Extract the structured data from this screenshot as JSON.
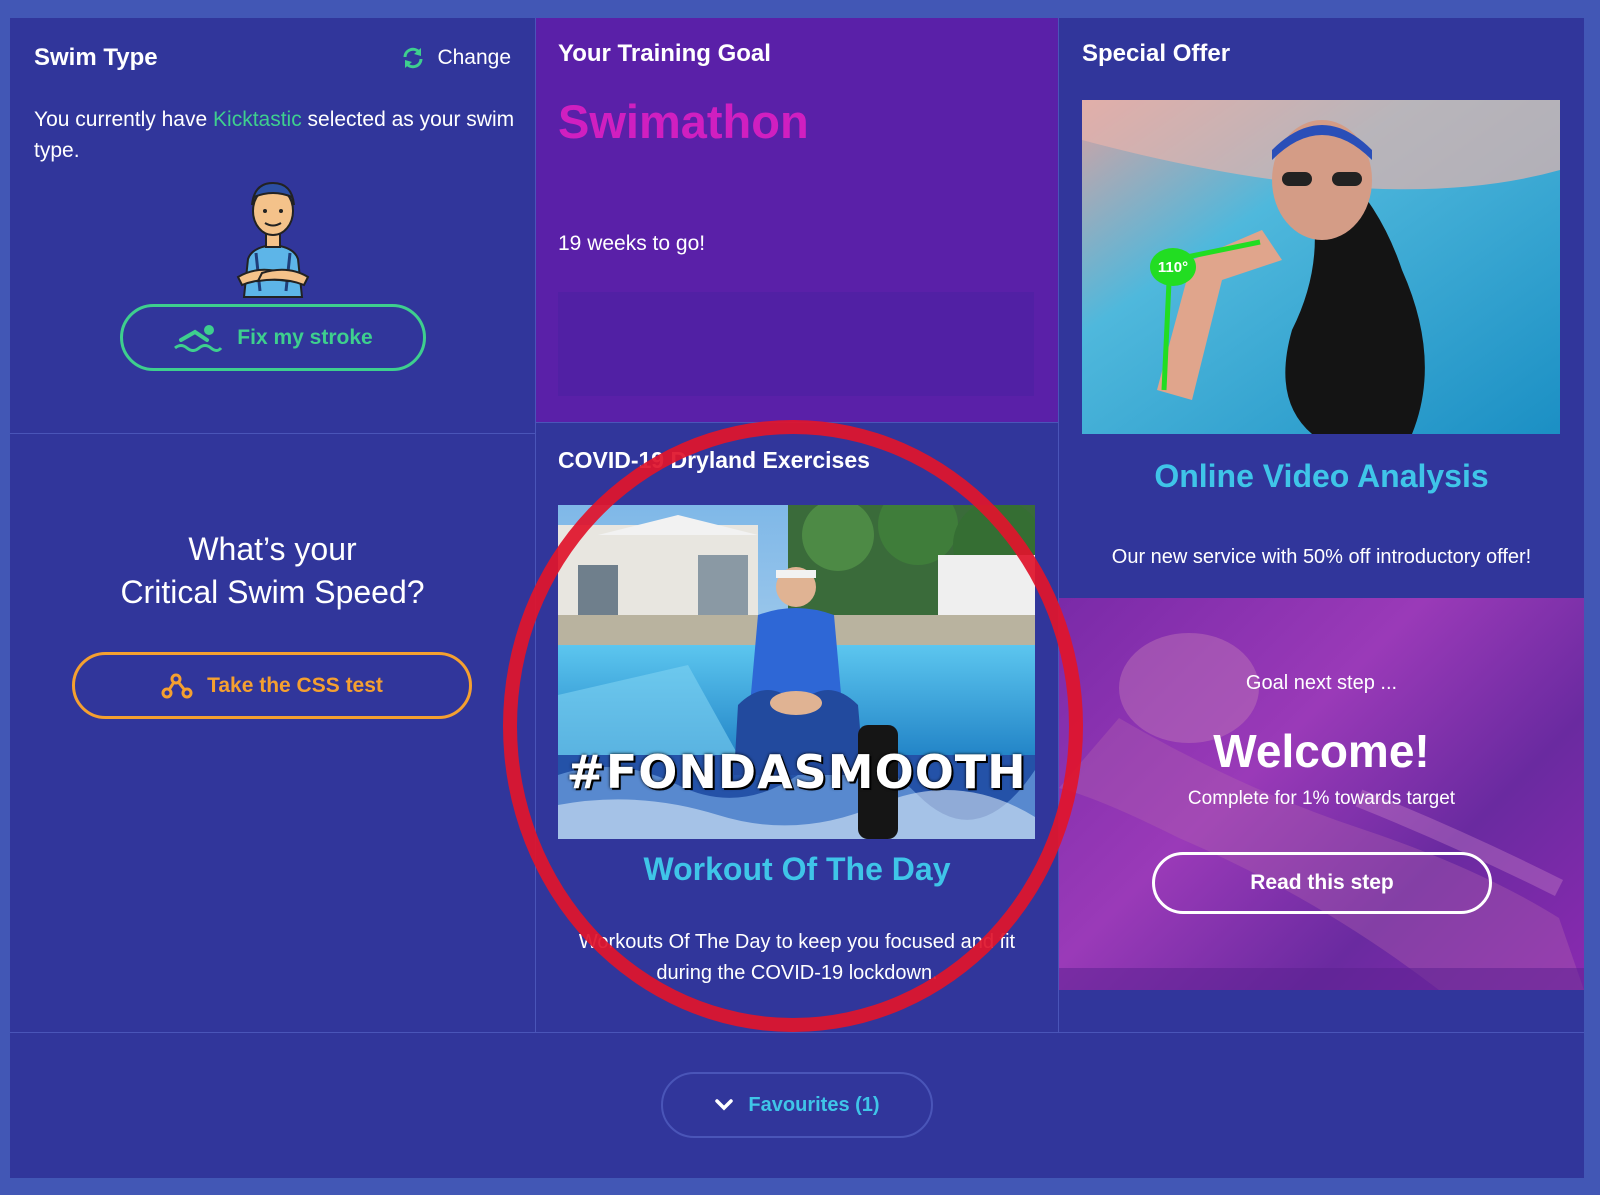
{
  "swim_type": {
    "title": "Swim Type",
    "change_label": "Change",
    "desc_before": "You currently have ",
    "desc_highlight": "Kicktastic",
    "desc_after": " selected as your swim type.",
    "fix_button": "Fix my stroke"
  },
  "css": {
    "title_line1": "What’s your",
    "title_line2": "Critical Swim Speed?",
    "button": "Take the CSS test"
  },
  "goal": {
    "title": "Your Training Goal",
    "name": "Swimathon",
    "weeks": "19 weeks to go!"
  },
  "dryland": {
    "title": "COVID-19 Dryland Exercises",
    "image_caption": "#FONDASMOOTH",
    "heading": "Workout Of The Day",
    "desc_line1": "Workouts Of The Day to keep you focused and fit",
    "desc_line2": "during the COVID-19 lockdown."
  },
  "offer": {
    "title": "Special Offer",
    "angle_badge": "110°",
    "heading": "Online Video Analysis",
    "desc": "Our new service with 50% off introductory offer!"
  },
  "next_step": {
    "label": "Goal next step ...",
    "heading": "Welcome!",
    "sub": "Complete for 1% towards target",
    "button": "Read this step"
  },
  "favourites": {
    "label": "Favourites (1)"
  },
  "colors": {
    "background": "#31369b",
    "goal_panel": "#5a20a8",
    "accent_green": "#3ecf8e",
    "accent_orange": "#f5a030",
    "accent_cyan": "#3fc5e8",
    "goal_magenta": "#d01fc0",
    "annotation_red": "#e0142c"
  }
}
